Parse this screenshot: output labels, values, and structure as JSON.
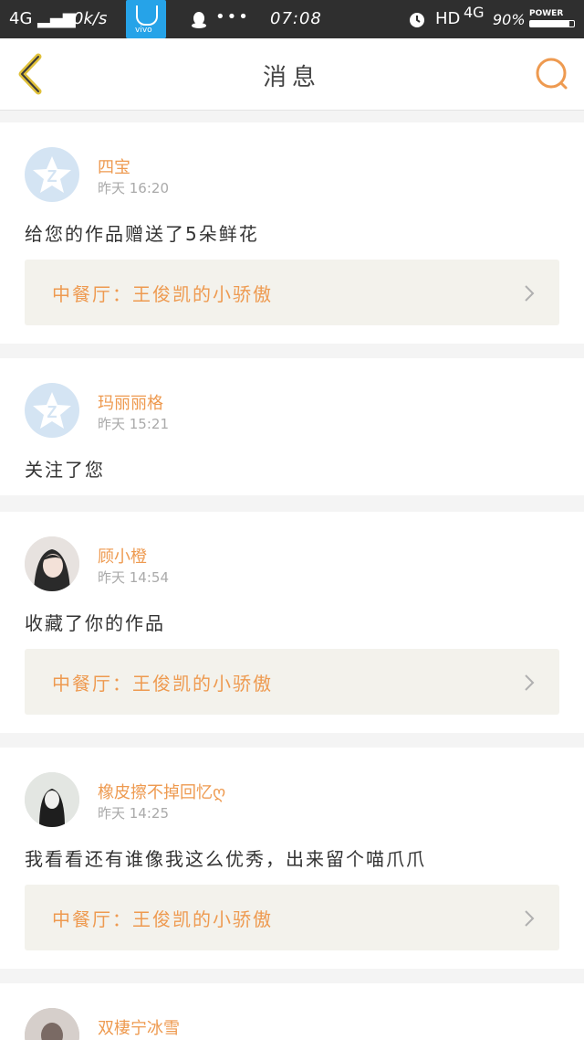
{
  "status_bar": {
    "signal": "4G",
    "net_speed": "0k/s",
    "vivo_label": "vivo",
    "dots": "•••",
    "time": "07:08",
    "hd": "HD",
    "network": "4G",
    "battery": "90%",
    "power_label": "POWER",
    "battery_level": 0.9
  },
  "header": {
    "title": "消息"
  },
  "colors": {
    "accent": "#ee9a50",
    "back_icon": "#e0c13a"
  },
  "messages": [
    {
      "user": "四宝",
      "time": "昨天 16:20",
      "text": "给您的作品赠送了5朵鲜花",
      "work": "中餐厅：王俊凯的小骄傲",
      "avatar": "default-avatar-icon"
    },
    {
      "user": "玛丽丽格",
      "time": "昨天 15:21",
      "text": "关注了您",
      "avatar": "default-avatar-icon"
    },
    {
      "user": "顾小橙",
      "time": "昨天 14:54",
      "text": "收藏了你的作品",
      "work": "中餐厅：王俊凯的小骄傲",
      "avatar": "photo-avatar"
    },
    {
      "user": "橡皮擦不掉回忆ღ",
      "time": "昨天 14:25",
      "text": "我看看还有谁像我这么优秀，出来留个喵爪爪",
      "work": "中餐厅：王俊凯的小骄傲",
      "avatar": "photo-avatar"
    },
    {
      "user": "双棲宁冰雪",
      "avatar": "photo-avatar"
    }
  ]
}
